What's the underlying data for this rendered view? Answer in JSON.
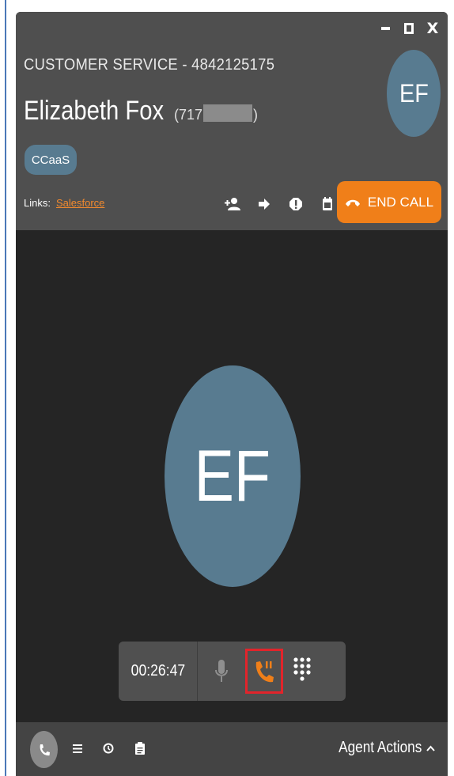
{
  "window": {
    "controls": {
      "minimize": "minimize-icon",
      "maximize": "maximize-icon",
      "close": "close-icon"
    }
  },
  "header": {
    "queue_line": "CUSTOMER SERVICE - 4842125175",
    "caller_name": "Elizabeth Fox",
    "caller_phone_prefix": "(717",
    "caller_phone_suffix": ")",
    "avatar_initials": "EF",
    "tag": "CCaaS",
    "links_label": "Links:",
    "link_salesforce": "Salesforce",
    "actions": [
      "add-participant-icon",
      "transfer-arrow-icon",
      "alert-icon",
      "calendar-icon"
    ],
    "end_call_label": "END CALL"
  },
  "main": {
    "avatar_initials": "EF",
    "call_controls": {
      "timer": "00:26:47",
      "buttons": [
        "microphone-icon",
        "hold-call-icon",
        "dialpad-icon"
      ]
    }
  },
  "footer": {
    "icons": [
      "phone-icon",
      "list-icon",
      "history-icon",
      "clipboard-icon"
    ],
    "agent_actions_label": "Agent Actions"
  },
  "colors": {
    "header_bg": "#4f4f4f",
    "main_bg": "#252525",
    "avatar": "#587b90",
    "accent_orange": "#f07f19",
    "highlight_red": "#e2242b",
    "footer_bg": "#444444"
  }
}
